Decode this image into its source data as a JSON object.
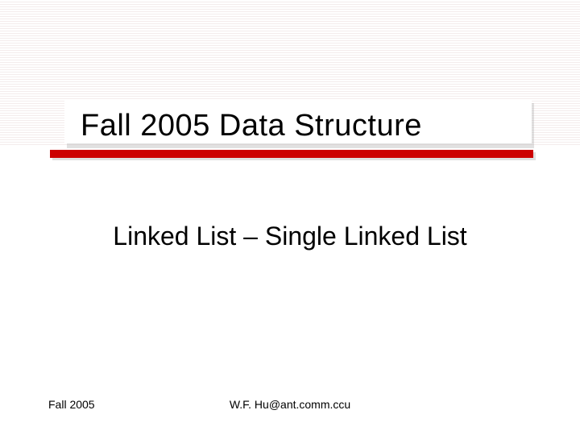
{
  "slide": {
    "title": "Fall 2005 Data Structure",
    "subtitle": "Linked List – Single Linked List"
  },
  "footer": {
    "left": "Fall 2005",
    "center": "W.F. Hu@ant.comm.ccu"
  },
  "colors": {
    "accent": "#cc0000"
  }
}
